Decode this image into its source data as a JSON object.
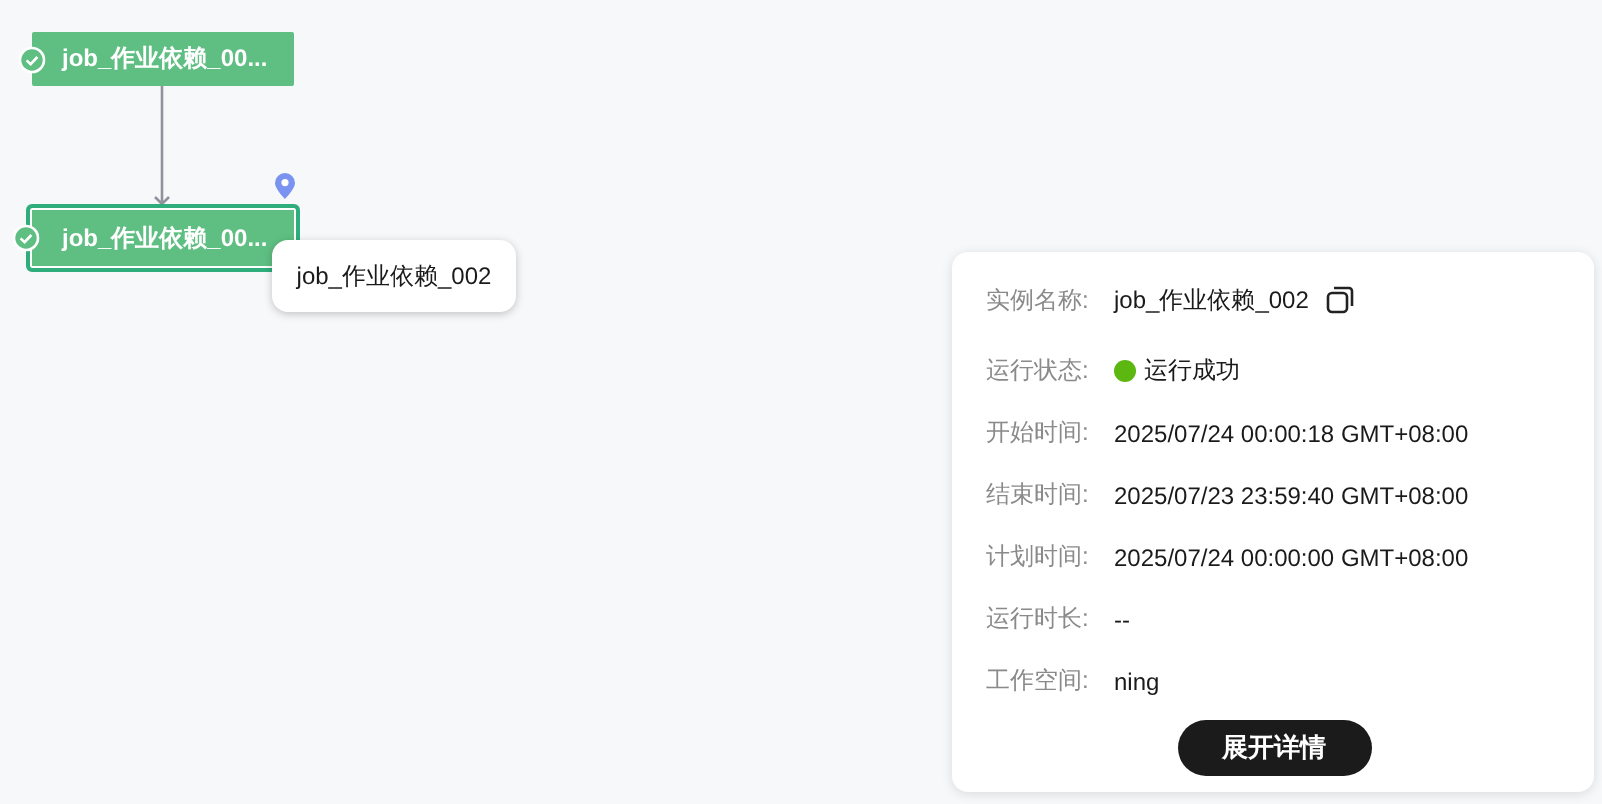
{
  "nodes": [
    {
      "label": "job_作业依赖_00...",
      "kind": "success",
      "selected": false,
      "pinned": false
    },
    {
      "label": "job_作业依赖_00...",
      "kind": "success",
      "selected": true,
      "pinned": true
    }
  ],
  "tooltip": "job_作业依赖_002",
  "details": {
    "rows": [
      {
        "label": "实例名称:",
        "value": "job_作业依赖_002",
        "kind": "copy"
      },
      {
        "label": "运行状态:",
        "value": "运行成功",
        "kind": "status",
        "color": "#5cb811"
      },
      {
        "label": "开始时间:",
        "value": "2025/07/24 00:00:18 GMT+08:00",
        "kind": "text"
      },
      {
        "label": "结束时间:",
        "value": "2025/07/23 23:59:40 GMT+08:00",
        "kind": "text"
      },
      {
        "label": "计划时间:",
        "value": "2025/07/24 00:00:00 GMT+08:00",
        "kind": "text"
      },
      {
        "label": "运行时长:",
        "value": "--",
        "kind": "text"
      },
      {
        "label": "工作空间:",
        "value": "ning",
        "kind": "text"
      }
    ],
    "button": "展开详情"
  }
}
